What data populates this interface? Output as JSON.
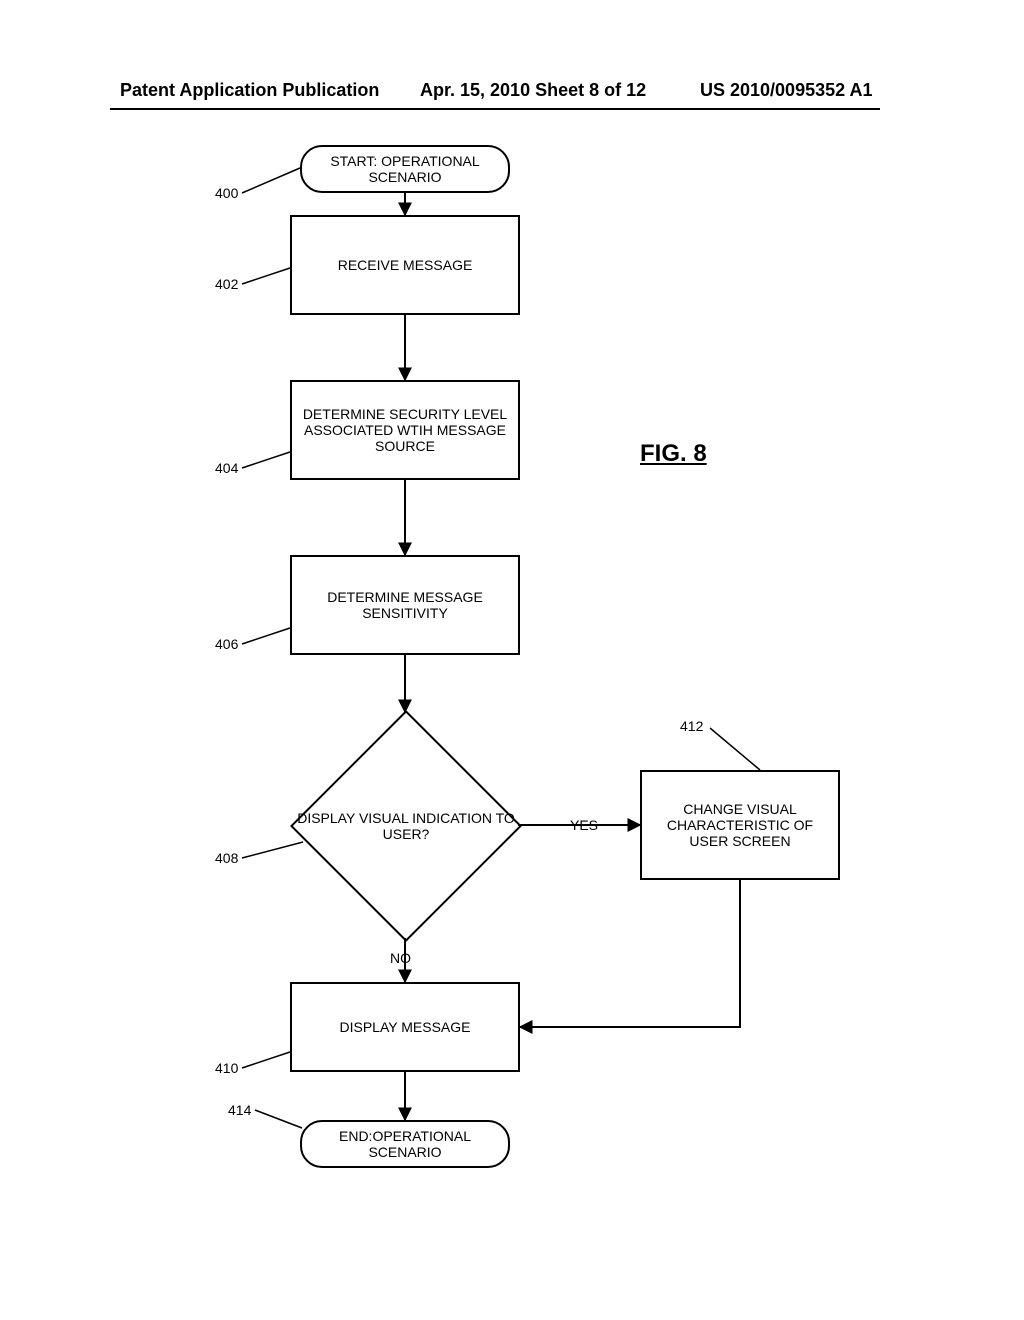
{
  "header": {
    "left": "Patent Application Publication",
    "mid": "Apr. 15, 2010  Sheet 8 of 12",
    "right": "US 2010/0095352 A1"
  },
  "figure_label": "FIG. 8",
  "nodes": {
    "start": {
      "ref": "400",
      "text": "START: OPERATIONAL SCENARIO"
    },
    "receive": {
      "ref": "402",
      "text": "RECEIVE MESSAGE"
    },
    "detsec": {
      "ref": "404",
      "text": "DETERMINE SECURITY LEVEL ASSOCIATED WTIH MESSAGE SOURCE"
    },
    "detsen": {
      "ref": "406",
      "text": "DETERMINE MESSAGE SENSITIVITY"
    },
    "disvis": {
      "ref": "408",
      "text": "DISPLAY VISUAL INDICATION TO USER?"
    },
    "change": {
      "ref": "412",
      "text": "CHANGE VISUAL CHARACTERISTIC OF USER SCREEN"
    },
    "display": {
      "ref": "410",
      "text": "DISPLAY MESSAGE"
    },
    "end": {
      "ref": "414",
      "text": "END:OPERATIONAL SCENARIO"
    }
  },
  "edges": {
    "disvis_yes": "YES",
    "disvis_no": "NO"
  }
}
